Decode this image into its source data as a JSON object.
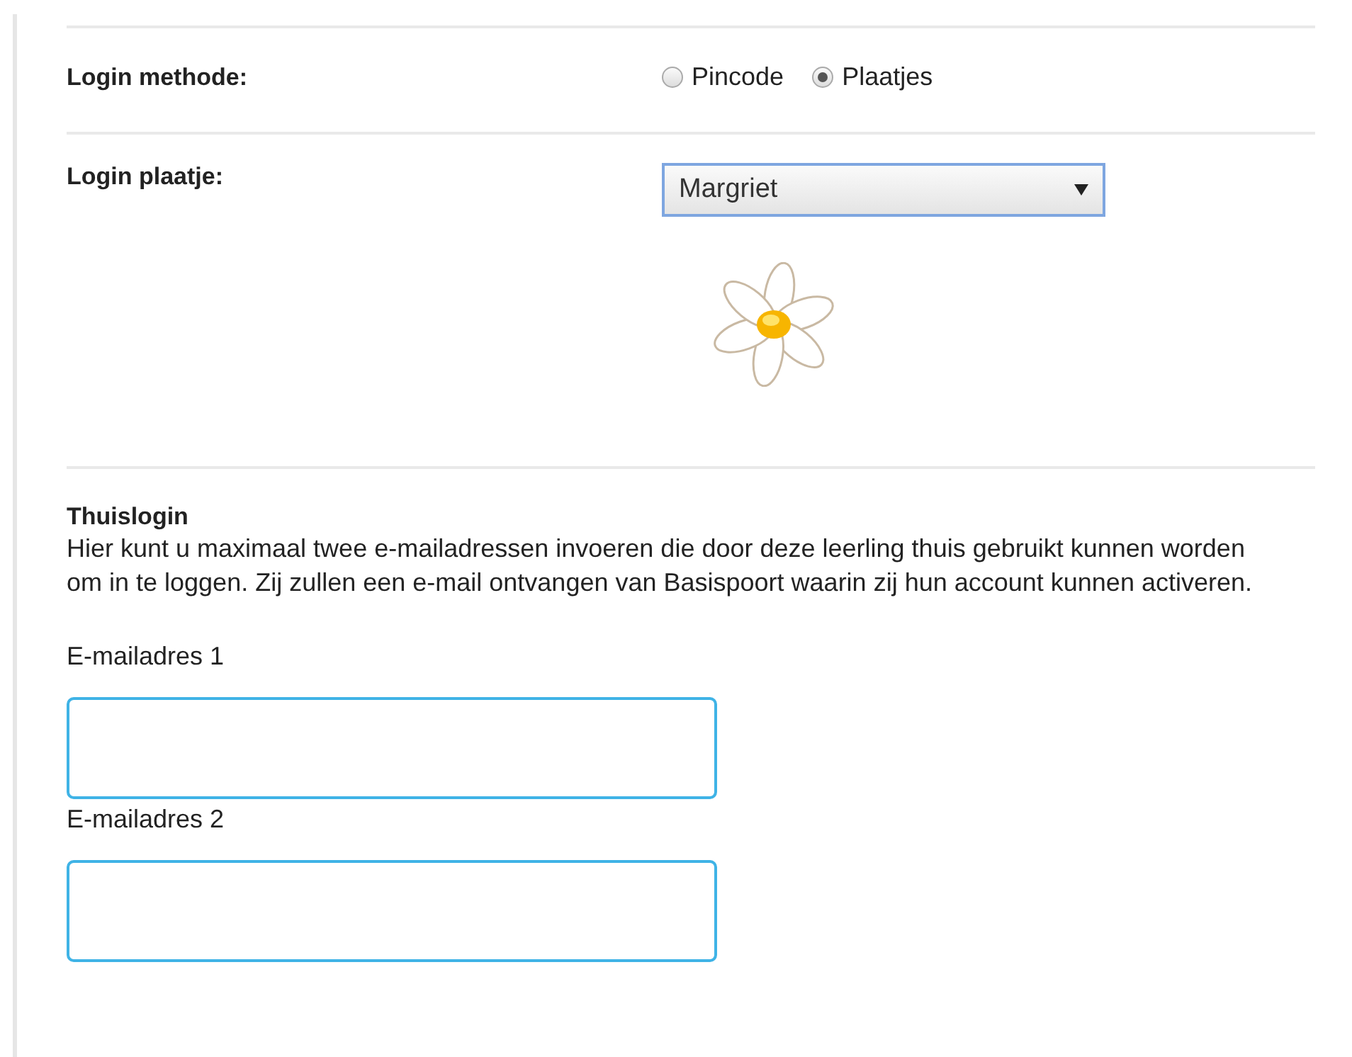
{
  "login_method": {
    "label": "Login methode:",
    "options": [
      {
        "label": "Pincode",
        "selected": false
      },
      {
        "label": "Plaatjes",
        "selected": true
      }
    ]
  },
  "login_picture": {
    "label": "Login plaatje:",
    "value": "Margriet"
  },
  "home_login": {
    "title": "Thuislogin",
    "description": "Hier kunt u maximaal twee e-mailadressen invoeren die door deze leerling thuis gebruikt kunnen worden om in te loggen. Zij zullen een e-mail ontvangen van Basispoort waarin zij hun account kunnen activeren.",
    "fields": [
      {
        "label": "E-mailadres 1"
      },
      {
        "label": "E-mailadres 2"
      }
    ]
  }
}
